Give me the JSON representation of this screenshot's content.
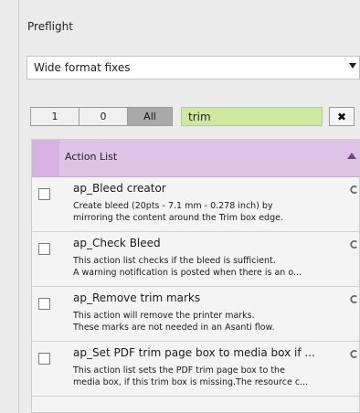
{
  "panel": {
    "title": "Preflight",
    "profile_value": "Wide format fixes"
  },
  "filters": {
    "buttons": [
      {
        "label": "1",
        "active": false
      },
      {
        "label": "0",
        "active": false
      },
      {
        "label": "All",
        "active": true
      }
    ],
    "search_value": "trim",
    "clear_label": "✖"
  },
  "list": {
    "header_label": "Action List",
    "rows": [
      {
        "title": "ap_Bleed creator",
        "desc_lines": [
          "Create bleed (20pts - 7.1 mm - 0.278 inch) by",
          "mirroring the content around the Trim box edge."
        ]
      },
      {
        "title": "ap_Check Bleed",
        "desc_lines": [
          "This action list checks if the bleed is sufficient.",
          "A warning notification is posted when there is an o..."
        ]
      },
      {
        "title": "ap_Remove trim marks",
        "desc_lines": [
          "This action will remove the printer marks.",
          "These marks are not needed in an Asanti flow."
        ]
      },
      {
        "title": "ap_Set PDF trim page box to media box if ...",
        "desc_lines": [
          "This action list sets the PDF trim page box to the",
          "media box, if this trim box is missing.The resource c..."
        ]
      }
    ]
  },
  "colors": {
    "header_bg": "#dfc3e6",
    "search_bg": "#cfe8a3",
    "active_seg_bg": "#a9a9a9"
  },
  "icons": {
    "dropdown": "chevron-down-icon",
    "sort": "sort-up-icon",
    "row_action": "partial-circle-icon"
  }
}
